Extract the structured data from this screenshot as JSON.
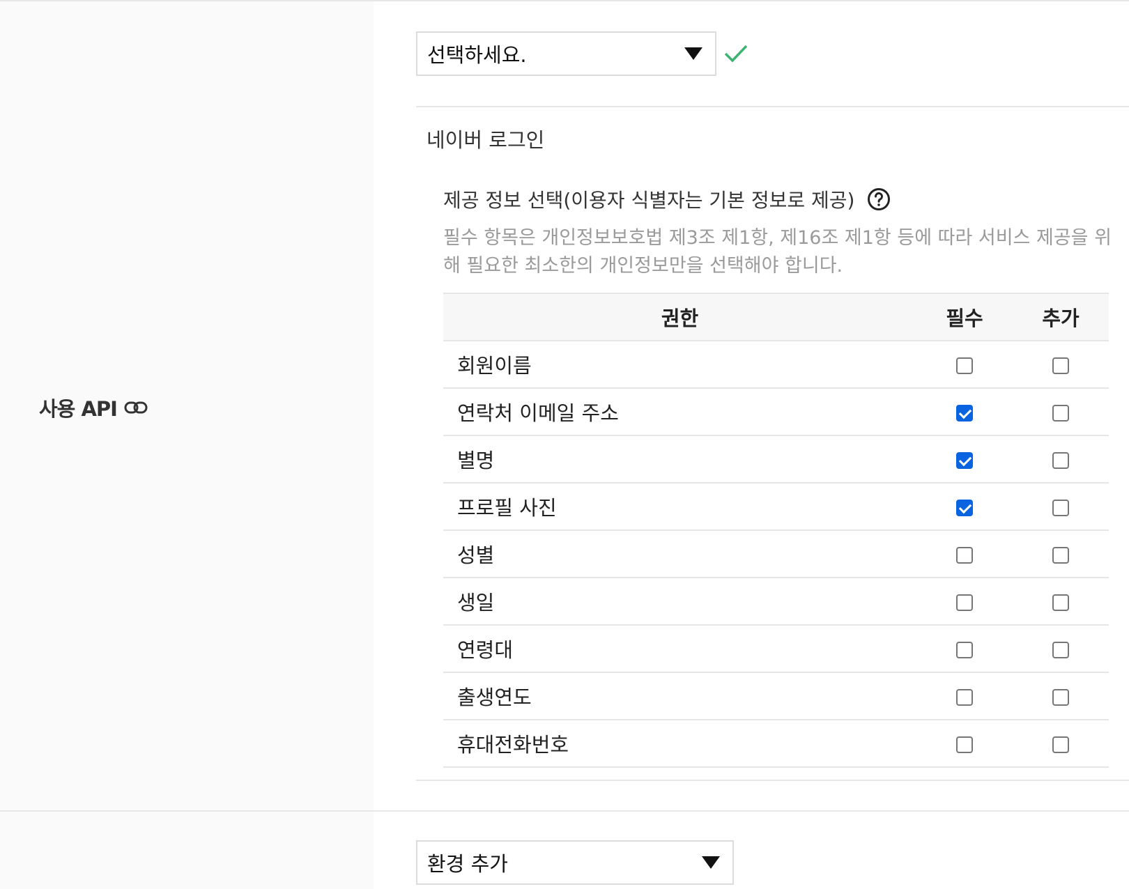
{
  "api_label": "사용 API",
  "top_select": {
    "value": "선택하세요."
  },
  "section": {
    "title": "네이버 로그인",
    "subtitle": "제공 정보 선택(이용자 식별자는 기본 정보로 제공)",
    "description": "필수 항목은 개인정보보호법 제3조 제1항, 제16조 제1항 등에 따라 서비스 제공을 위해 필요한 최소한의 개인정보만을 선택해야 합니다."
  },
  "table": {
    "headers": {
      "permission": "권한",
      "required": "필수",
      "additional": "추가"
    },
    "rows": [
      {
        "name": "회원이름",
        "required": false,
        "additional": false
      },
      {
        "name": "연락처 이메일 주소",
        "required": true,
        "additional": false
      },
      {
        "name": "별명",
        "required": true,
        "additional": false
      },
      {
        "name": "프로필 사진",
        "required": true,
        "additional": false
      },
      {
        "name": "성별",
        "required": false,
        "additional": false
      },
      {
        "name": "생일",
        "required": false,
        "additional": false
      },
      {
        "name": "연령대",
        "required": false,
        "additional": false
      },
      {
        "name": "출생연도",
        "required": false,
        "additional": false
      },
      {
        "name": "휴대전화번호",
        "required": false,
        "additional": false
      }
    ]
  },
  "bottom_select": {
    "value": "환경 추가"
  },
  "colors": {
    "check_green": "#3cb371",
    "checkbox_blue": "#0a63e0"
  }
}
